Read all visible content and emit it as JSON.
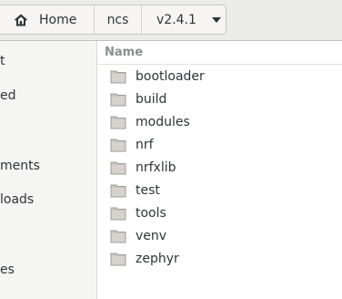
{
  "pathbar": {
    "home_label": "Home",
    "ncs_label": "ncs",
    "version_label": "v2.4.1"
  },
  "sidebar": {
    "items": [
      {
        "label": "t"
      },
      {
        "label": "ed"
      },
      {
        "label": "ments"
      },
      {
        "label": "loads"
      },
      {
        "label": "es"
      }
    ]
  },
  "file_list": {
    "column_name": "Name",
    "rows": [
      {
        "name": "bootloader"
      },
      {
        "name": "build"
      },
      {
        "name": "modules"
      },
      {
        "name": "nrf"
      },
      {
        "name": "nrfxlib"
      },
      {
        "name": "test"
      },
      {
        "name": "tools"
      },
      {
        "name": "venv"
      },
      {
        "name": "zephyr"
      }
    ]
  },
  "colors": {
    "folder_fill": "#c8c4bf",
    "header_bg": "#ebebe9",
    "sidebar_bg": "#f5f5f4"
  }
}
